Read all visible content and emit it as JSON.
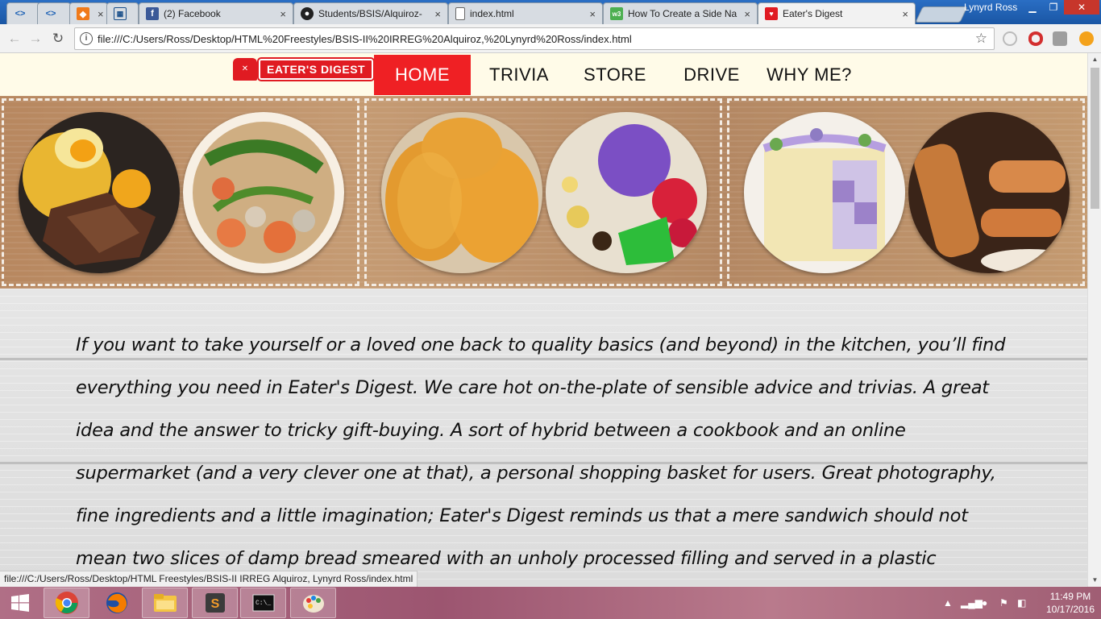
{
  "browser": {
    "tabs": [
      {
        "title": "",
        "icon": "code-icon"
      },
      {
        "title": "",
        "icon": "code-icon"
      },
      {
        "title": "",
        "icon": "orange-box-icon"
      },
      {
        "title": "",
        "icon": "grid-icon"
      },
      {
        "title": "(2) Facebook",
        "icon": "facebook-icon"
      },
      {
        "title": "Students/BSIS/Alquiroz-",
        "icon": "github-icon"
      },
      {
        "title": "index.html",
        "icon": "file-icon"
      },
      {
        "title": "How To Create a Side Na",
        "icon": "w3-icon"
      },
      {
        "title": "Eater's Digest",
        "icon": "eaters-digest-icon"
      }
    ],
    "profile_name": "Lynyrd Ross",
    "url": "file:///C:/Users/Ross/Desktop/HTML%20Freestyles/BSIS-II%20IRREG%20Alquiroz,%20Lynyrd%20Ross/index.html",
    "status_url": "file:///C:/Users/Ross/Desktop/HTML Freestyles/BSIS-II IRREG Alquiroz, Lynyrd Ross/index.html"
  },
  "site": {
    "logo_text": "EATER'S DIGEST",
    "nav": [
      {
        "label": "HOME",
        "active": true
      },
      {
        "label": "TRIVIA",
        "active": false
      },
      {
        "label": "STORE",
        "active": false
      },
      {
        "label": "DRIVE",
        "active": false
      },
      {
        "label": "WHY ME?",
        "active": false
      }
    ],
    "banner_images": [
      "tapa-silog-plate",
      "sinigang-na-hipon",
      "sesame-buchi",
      "halo-halo-ube",
      "ube-checkerboard-cake",
      "lumpia-rolls"
    ],
    "intro": "If you want to take yourself or a loved one back to quality basics (and beyond) in the kitchen, you’ll find everything you need in Eater's Digest. We care hot on-the-plate of sensible advice and trivias. A great idea and the answer to tricky gift-buying. A sort of hybrid between a cookbook and an online supermarket (and a very clever one at that), a personal shopping basket for users. Great photography, fine ingredients and a little imagination; Eater's Digest reminds us that a mere sandwich should not mean two slices of damp bread smeared with an unholy processed filling and served in a plastic"
  },
  "taskbar": {
    "apps": [
      "chrome-icon",
      "firefox-icon",
      "file-explorer-icon",
      "sublime-text-icon",
      "command-prompt-icon",
      "paint-icon"
    ],
    "time": "11:49 PM",
    "date": "10/17/2016"
  },
  "colors": {
    "accent_red": "#ef2024",
    "nav_bg": "#fffbe8",
    "chrome_blue": "#1d5fb3"
  }
}
